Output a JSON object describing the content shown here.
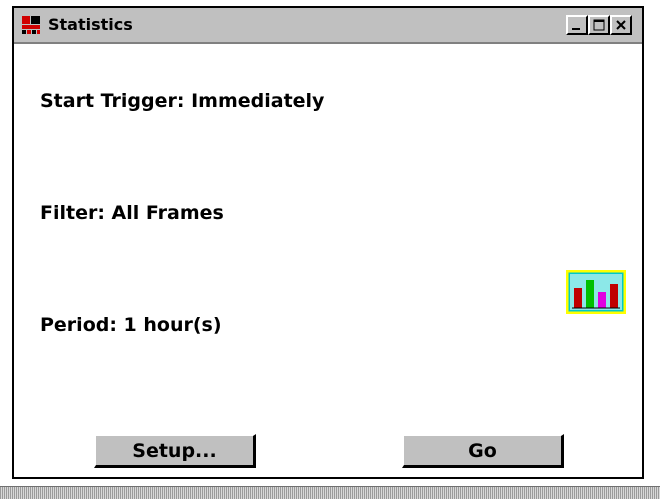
{
  "window": {
    "title": "Statistics",
    "app_icon": "network-monitor-icon",
    "controls": {
      "minimize_icon": "minimize-icon",
      "maximize_icon": "maximize-icon",
      "close_icon": "close-icon"
    }
  },
  "stats": {
    "start_trigger": "Start Trigger: Immediately",
    "filter": "Filter: All Frames",
    "period": "Period: 1 hour(s)"
  },
  "stats_icon": "bar-chart-icon",
  "buttons": {
    "setup_label": "Setup...",
    "go_label": "Go"
  },
  "colors": {
    "window_frame": "#c0c0c0",
    "icon_bar_red": "#c00000",
    "icon_bar_green": "#00c000",
    "icon_bar_magenta": "#e000e0",
    "icon_border": "#ffff00"
  }
}
